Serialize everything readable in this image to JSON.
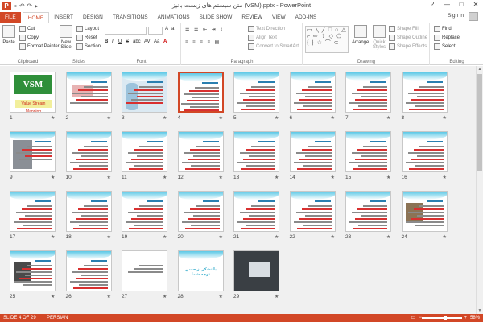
{
  "window": {
    "title": "متن سیستم های زیست بانیز (VSM).pptx - PowerPoint",
    "app_icon": "P",
    "controls": [
      "?",
      "—",
      "□",
      "✕"
    ]
  },
  "tabs": [
    "FILE",
    "HOME",
    "INSERT",
    "DESIGN",
    "TRANSITIONS",
    "ANIMATIONS",
    "SLIDE SHOW",
    "REVIEW",
    "VIEW",
    "ADD-INS"
  ],
  "active_tab": "HOME",
  "account": {
    "label": "Sign in"
  },
  "ribbon": {
    "clipboard": {
      "label": "Clipboard",
      "paste": "Paste",
      "cut": "Cut",
      "copy": "Copy",
      "format_painter": "Format Painter"
    },
    "slides": {
      "label": "Slides",
      "new_slide": "New Slide",
      "layout": "Layout",
      "reset": "Reset",
      "section": "Section"
    },
    "font": {
      "label": "Font",
      "bold": "B",
      "italic": "I",
      "underline": "U",
      "strike": "S",
      "shadow": "abc",
      "spacing": "AV",
      "case": "Aa",
      "color": "A"
    },
    "paragraph": {
      "label": "Paragraph",
      "text_direction": "Text Direction",
      "align_text": "Align Text",
      "smartart": "Convert to SmartArt"
    },
    "drawing": {
      "label": "Drawing",
      "arrange": "Arrange",
      "quick_styles": "Quick Styles",
      "shape_fill": "Shape Fill",
      "shape_outline": "Shape Outline",
      "shape_effects": "Shape Effects",
      "shapes_glyphs": "▭ ╲ ╱ □ ○ △ ⌐ ⇨ ⇧ ◇ ⬠ { } ☆ ⌒ ⊂"
    },
    "editing": {
      "label": "Editing",
      "find": "Find",
      "replace": "Replace",
      "select": "Select"
    }
  },
  "slides": [
    {
      "num": "1",
      "kind": "vsm",
      "logo": "VSM",
      "subtitle": "Value Stream Mapping"
    },
    {
      "num": "2",
      "kind": "diagram"
    },
    {
      "num": "3",
      "kind": "bluecircles"
    },
    {
      "num": "4",
      "kind": "text",
      "selected": true
    },
    {
      "num": "5",
      "kind": "text"
    },
    {
      "num": "6",
      "kind": "text"
    },
    {
      "num": "7",
      "kind": "text"
    },
    {
      "num": "8",
      "kind": "text"
    },
    {
      "num": "9",
      "kind": "machine"
    },
    {
      "num": "10",
      "kind": "text"
    },
    {
      "num": "11",
      "kind": "text"
    },
    {
      "num": "12",
      "kind": "text"
    },
    {
      "num": "13",
      "kind": "text"
    },
    {
      "num": "14",
      "kind": "text"
    },
    {
      "num": "15",
      "kind": "text"
    },
    {
      "num": "16",
      "kind": "text"
    },
    {
      "num": "17",
      "kind": "text"
    },
    {
      "num": "18",
      "kind": "text"
    },
    {
      "num": "19",
      "kind": "text"
    },
    {
      "num": "20",
      "kind": "text"
    },
    {
      "num": "21",
      "kind": "text"
    },
    {
      "num": "22",
      "kind": "text"
    },
    {
      "num": "23",
      "kind": "text"
    },
    {
      "num": "24",
      "kind": "photo"
    },
    {
      "num": "25",
      "kind": "photo2"
    },
    {
      "num": "26",
      "kind": "text"
    },
    {
      "num": "27",
      "kind": "plain"
    },
    {
      "num": "28",
      "kind": "thanks",
      "text": "با تشکر از حسن توجه شما"
    },
    {
      "num": "29",
      "kind": "laptop"
    }
  ],
  "slide_star": "★",
  "statusbar": {
    "slide_info": "SLIDE 4 OF 29",
    "language": "PERSIAN",
    "zoom": "58%",
    "zoom_minus": "−",
    "zoom_plus": "+",
    "zoom_fraction": 0.58,
    "scroll_up": "▲",
    "scroll_down": "▼"
  }
}
